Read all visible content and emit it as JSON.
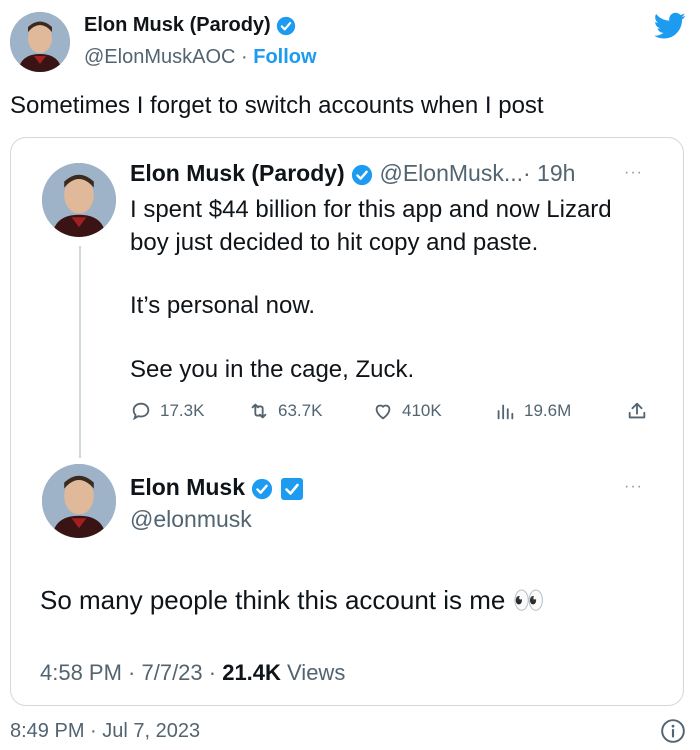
{
  "outer_tweet": {
    "display_name": "Elon Musk (Parody)",
    "handle": "@ElonMuskAOC",
    "separator": " · ",
    "follow_label": "Follow",
    "text": "Sometimes I forget to switch accounts when I post",
    "timestamp": "8:49 PM · Jul 7, 2023"
  },
  "quoted_parent": {
    "display_name": "Elon Musk (Parody)",
    "handle_truncated": "@ElonMusk...",
    "age": "· 19h",
    "more_label": "···",
    "lines": [
      "I spent $44 billion for this app and now Lizard",
      "boy just decided to hit copy and paste.",
      "It’s personal now.",
      "See you in the cage, Zuck."
    ],
    "actions": {
      "replies": "17.3K",
      "retweets": "63.7K",
      "likes": "410K",
      "views": "19.6M"
    }
  },
  "quoted_reply": {
    "display_name": "Elon Musk",
    "handle": "@elonmusk",
    "more_label": "···",
    "text": "So many people think this account is me",
    "emoji": "👀",
    "footer": {
      "time_date": "4:58 PM · 7/7/23 · ",
      "views_count": "21.4K",
      "views_label": " Views"
    }
  },
  "colors": {
    "accent": "#1d9bf0",
    "secondary_text": "#536471",
    "border": "#cfd9de",
    "gov_badge": "#1d9bf0"
  },
  "icons": [
    "twitter-bird-icon",
    "verified-badge-icon",
    "reply-icon",
    "retweet-icon",
    "like-icon",
    "views-icon",
    "share-icon",
    "info-icon",
    "more-icon"
  ]
}
